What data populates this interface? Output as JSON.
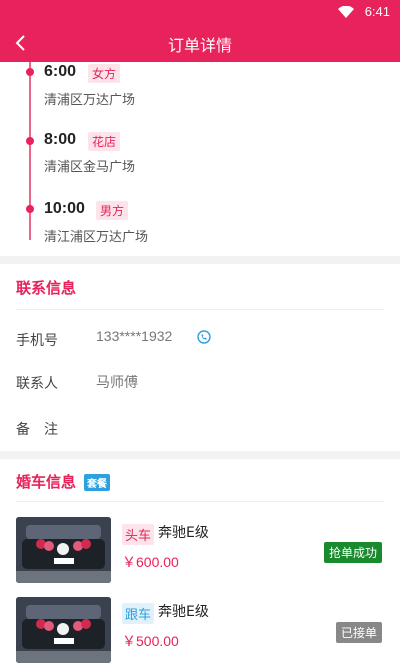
{
  "status_bar": {
    "time": "6:41",
    "wifi_icon": "wifi-icon"
  },
  "header": {
    "title": "订单详情",
    "back_icon": "back-arrow-icon"
  },
  "timeline": [
    {
      "time": "6:00",
      "tag": "女方",
      "address": "清浦区万达广场"
    },
    {
      "time": "8:00",
      "tag": "花店",
      "address": "清浦区金马广场"
    },
    {
      "time": "10:00",
      "tag": "男方",
      "address": "清江浦区万达广场"
    }
  ],
  "contact": {
    "title": "联系信息",
    "phone_label": "手机号",
    "phone_value": "133****1932",
    "phone_icon": "phone-call-icon",
    "contact_label": "联系人",
    "contact_value": "马师傅",
    "note_label": "备　注",
    "note_value": ""
  },
  "cars": {
    "title": "婚车信息",
    "package_badge": "套餐",
    "items": [
      {
        "tag": "头车",
        "name": "奔驰E级",
        "price": "￥600.00",
        "status": "抢单成功",
        "status_color": "#1a8a2e",
        "tag_color": "#e8225a",
        "tag_bg": "#fde3ea"
      },
      {
        "tag": "跟车",
        "name": "奔驰E级",
        "price": "￥500.00",
        "status": "已接单",
        "status_color": "#888888",
        "tag_color": "#2da0e0",
        "tag_bg": "#e1f1fb"
      }
    ]
  },
  "colors": {
    "accent": "#e8225a",
    "success": "#1a8a2e",
    "info": "#2da0e0"
  }
}
